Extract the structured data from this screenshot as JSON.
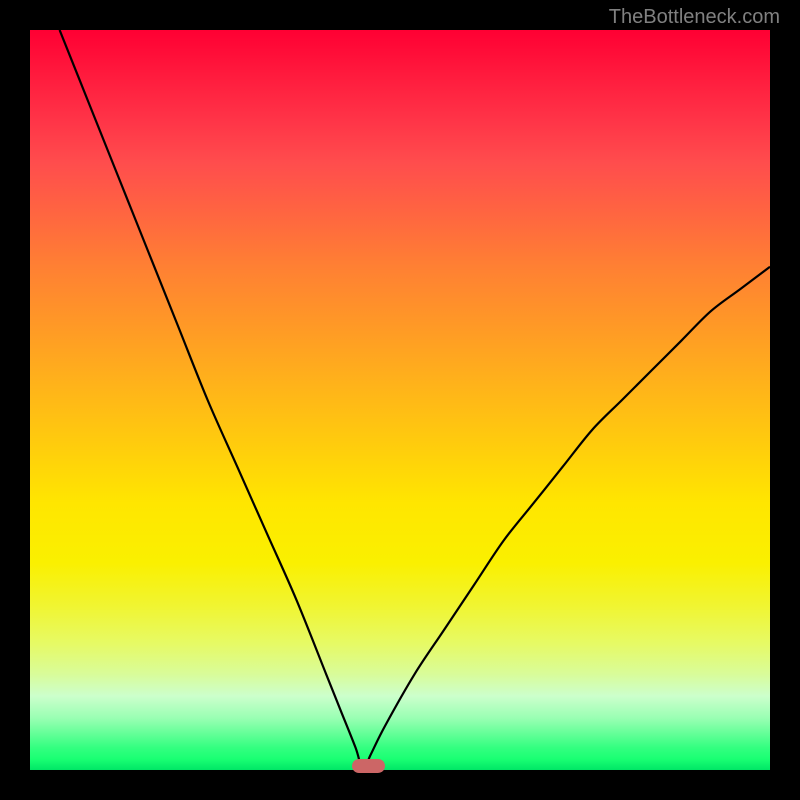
{
  "watermark": "TheBottleneck.com",
  "chart_data": {
    "type": "line",
    "title": "",
    "xlabel": "",
    "ylabel": "",
    "xlim": [
      0,
      100
    ],
    "ylim": [
      0,
      100
    ],
    "series": [
      {
        "name": "bottleneck-curve",
        "x": [
          4,
          8,
          12,
          16,
          20,
          24,
          28,
          32,
          36,
          40,
          42,
          44,
          45,
          46,
          48,
          52,
          56,
          60,
          64,
          68,
          72,
          76,
          80,
          84,
          88,
          92,
          96,
          100
        ],
        "values": [
          100,
          90,
          80,
          70,
          60,
          50,
          41,
          32,
          23,
          13,
          8,
          3,
          0,
          2,
          6,
          13,
          19,
          25,
          31,
          36,
          41,
          46,
          50,
          54,
          58,
          62,
          65,
          68
        ]
      }
    ],
    "marker": {
      "x_start": 43.5,
      "x_end": 48,
      "y": 0.5,
      "color": "#cc6666"
    },
    "gradient_colors": {
      "top": "#ff0033",
      "middle": "#ffe600",
      "bottom": "#00e666"
    }
  },
  "layout": {
    "frame_size": 800,
    "plot_inset": 30,
    "plot_size": 740
  }
}
